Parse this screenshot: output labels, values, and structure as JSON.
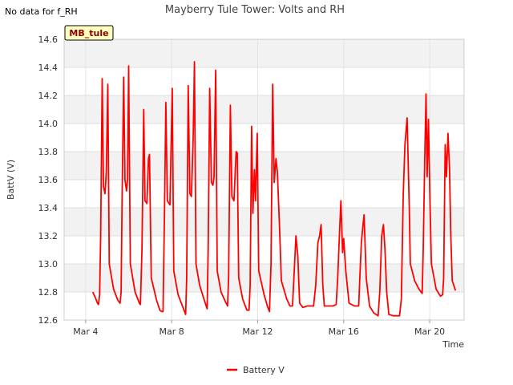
{
  "note": "No data for f_RH",
  "chart_data": {
    "type": "line",
    "title": "Mayberry Tule Tower: Volts and RH",
    "xlabel": "Time",
    "ylabel": "BattV (V)",
    "site_tag": "MB_tule",
    "ylim": [
      12.6,
      14.6
    ],
    "xlim": [
      3.0,
      21.6
    ],
    "yticks": [
      "12.6",
      "12.8",
      "13.0",
      "13.2",
      "13.4",
      "13.6",
      "13.8",
      "14.0",
      "14.2",
      "14.4",
      "14.6"
    ],
    "xticks": [
      {
        "value": 4,
        "label": "Mar 4"
      },
      {
        "value": 8,
        "label": "Mar 8"
      },
      {
        "value": 12,
        "label": "Mar 12"
      },
      {
        "value": 16,
        "label": "Mar 16"
      },
      {
        "value": 20,
        "label": "Mar 20"
      }
    ],
    "grid": true,
    "legend_position": "bottom-center",
    "series": [
      {
        "name": "Battery V",
        "color": "#ff0000",
        "points": [
          [
            4.33,
            12.8
          ],
          [
            4.45,
            12.76
          ],
          [
            4.55,
            12.72
          ],
          [
            4.6,
            12.71
          ],
          [
            4.65,
            12.78
          ],
          [
            4.7,
            13.2
          ],
          [
            4.77,
            14.32
          ],
          [
            4.83,
            13.55
          ],
          [
            4.9,
            13.5
          ],
          [
            4.96,
            13.65
          ],
          [
            5.03,
            14.28
          ],
          [
            5.1,
            13.0
          ],
          [
            5.3,
            12.82
          ],
          [
            5.5,
            12.74
          ],
          [
            5.6,
            12.72
          ],
          [
            5.65,
            12.8
          ],
          [
            5.7,
            13.5
          ],
          [
            5.77,
            14.33
          ],
          [
            5.83,
            13.6
          ],
          [
            5.9,
            13.52
          ],
          [
            5.95,
            13.6
          ],
          [
            6.0,
            14.41
          ],
          [
            6.08,
            13.0
          ],
          [
            6.3,
            12.8
          ],
          [
            6.5,
            12.72
          ],
          [
            6.55,
            12.71
          ],
          [
            6.62,
            13.1
          ],
          [
            6.7,
            14.1
          ],
          [
            6.76,
            13.45
          ],
          [
            6.85,
            13.43
          ],
          [
            6.92,
            13.75
          ],
          [
            6.97,
            13.78
          ],
          [
            7.05,
            12.9
          ],
          [
            7.3,
            12.74
          ],
          [
            7.45,
            12.67
          ],
          [
            7.55,
            12.66
          ],
          [
            7.6,
            12.66
          ],
          [
            7.67,
            13.4
          ],
          [
            7.73,
            14.15
          ],
          [
            7.8,
            13.45
          ],
          [
            7.92,
            13.42
          ],
          [
            8.03,
            14.25
          ],
          [
            8.1,
            12.95
          ],
          [
            8.3,
            12.78
          ],
          [
            8.5,
            12.7
          ],
          [
            8.65,
            12.64
          ],
          [
            8.7,
            12.9
          ],
          [
            8.77,
            14.27
          ],
          [
            8.85,
            13.5
          ],
          [
            8.92,
            13.48
          ],
          [
            9.0,
            13.9
          ],
          [
            9.06,
            14.44
          ],
          [
            9.13,
            13.0
          ],
          [
            9.3,
            12.85
          ],
          [
            9.5,
            12.75
          ],
          [
            9.65,
            12.68
          ],
          [
            9.7,
            13.1
          ],
          [
            9.77,
            14.25
          ],
          [
            9.85,
            13.58
          ],
          [
            9.92,
            13.56
          ],
          [
            9.97,
            13.62
          ],
          [
            10.05,
            14.38
          ],
          [
            10.12,
            12.95
          ],
          [
            10.3,
            12.8
          ],
          [
            10.5,
            12.73
          ],
          [
            10.6,
            12.7
          ],
          [
            10.65,
            12.9
          ],
          [
            10.73,
            14.13
          ],
          [
            10.8,
            13.48
          ],
          [
            10.9,
            13.45
          ],
          [
            11.0,
            13.8
          ],
          [
            11.05,
            13.79
          ],
          [
            11.12,
            12.9
          ],
          [
            11.3,
            12.75
          ],
          [
            11.5,
            12.67
          ],
          [
            11.6,
            12.67
          ],
          [
            11.65,
            12.85
          ],
          [
            11.72,
            13.98
          ],
          [
            11.78,
            13.36
          ],
          [
            11.85,
            13.67
          ],
          [
            11.9,
            13.45
          ],
          [
            11.98,
            13.93
          ],
          [
            12.05,
            12.95
          ],
          [
            12.3,
            12.78
          ],
          [
            12.45,
            12.7
          ],
          [
            12.55,
            12.66
          ],
          [
            12.62,
            13.0
          ],
          [
            12.7,
            14.28
          ],
          [
            12.77,
            13.58
          ],
          [
            12.85,
            13.75
          ],
          [
            12.92,
            13.65
          ],
          [
            13.02,
            13.25
          ],
          [
            13.1,
            12.88
          ],
          [
            13.35,
            12.75
          ],
          [
            13.5,
            12.7
          ],
          [
            13.62,
            12.7
          ],
          [
            13.7,
            12.95
          ],
          [
            13.78,
            13.2
          ],
          [
            13.87,
            13.05
          ],
          [
            13.95,
            12.72
          ],
          [
            14.1,
            12.69
          ],
          [
            14.3,
            12.7
          ],
          [
            14.6,
            12.7
          ],
          [
            14.7,
            12.85
          ],
          [
            14.8,
            13.15
          ],
          [
            14.88,
            13.2
          ],
          [
            14.95,
            13.28
          ],
          [
            15.03,
            12.85
          ],
          [
            15.1,
            12.7
          ],
          [
            15.5,
            12.7
          ],
          [
            15.65,
            12.71
          ],
          [
            15.72,
            12.9
          ],
          [
            15.8,
            13.2
          ],
          [
            15.87,
            13.45
          ],
          [
            15.95,
            13.08
          ],
          [
            16.0,
            13.18
          ],
          [
            16.1,
            12.95
          ],
          [
            16.25,
            12.72
          ],
          [
            16.5,
            12.7
          ],
          [
            16.7,
            12.7
          ],
          [
            16.75,
            12.9
          ],
          [
            16.82,
            13.15
          ],
          [
            16.9,
            13.28
          ],
          [
            16.95,
            13.35
          ],
          [
            17.05,
            12.9
          ],
          [
            17.2,
            12.7
          ],
          [
            17.4,
            12.65
          ],
          [
            17.6,
            12.63
          ],
          [
            17.68,
            12.8
          ],
          [
            17.77,
            13.2
          ],
          [
            17.85,
            13.28
          ],
          [
            17.92,
            13.1
          ],
          [
            18.0,
            12.8
          ],
          [
            18.1,
            12.64
          ],
          [
            18.3,
            12.63
          ],
          [
            18.6,
            12.63
          ],
          [
            18.68,
            12.75
          ],
          [
            18.77,
            13.5
          ],
          [
            18.85,
            13.85
          ],
          [
            18.95,
            14.04
          ],
          [
            19.05,
            13.4
          ],
          [
            19.1,
            13.0
          ],
          [
            19.3,
            12.88
          ],
          [
            19.5,
            12.82
          ],
          [
            19.65,
            12.79
          ],
          [
            19.7,
            13.1
          ],
          [
            19.77,
            13.75
          ],
          [
            19.83,
            14.21
          ],
          [
            19.88,
            13.62
          ],
          [
            19.94,
            14.03
          ],
          [
            20.02,
            13.4
          ],
          [
            20.08,
            13.0
          ],
          [
            20.3,
            12.82
          ],
          [
            20.5,
            12.77
          ],
          [
            20.6,
            12.78
          ],
          [
            20.65,
            12.9
          ],
          [
            20.72,
            13.85
          ],
          [
            20.78,
            13.62
          ],
          [
            20.85,
            13.93
          ],
          [
            20.92,
            13.68
          ],
          [
            20.98,
            13.2
          ],
          [
            21.05,
            12.88
          ],
          [
            21.2,
            12.81
          ]
        ]
      }
    ]
  }
}
